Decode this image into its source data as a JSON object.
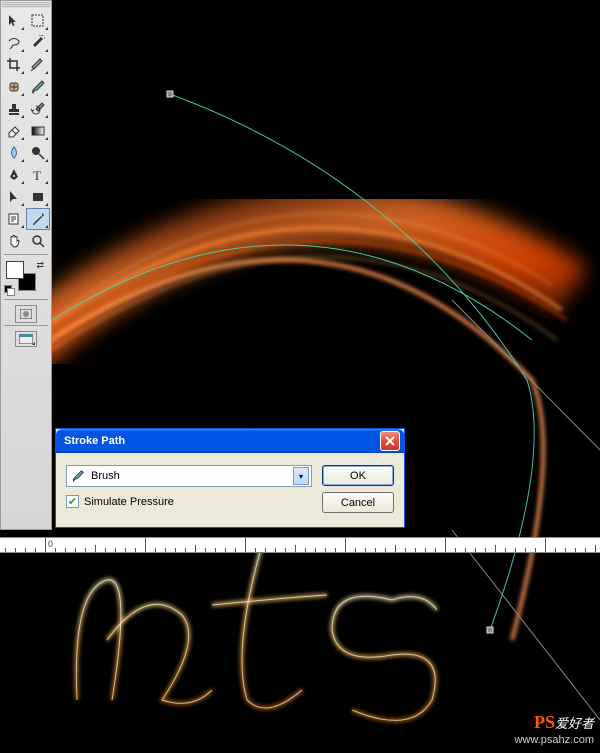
{
  "dialog": {
    "title": "Stroke Path",
    "tool_label": "Brush",
    "simulate_pressure_label": "Simulate Pressure",
    "simulate_pressure_checked": true,
    "ok_label": "OK",
    "cancel_label": "Cancel"
  },
  "ruler": {
    "major_label": "0"
  },
  "watermark": {
    "prefix": "PS",
    "suffix": "爱好者",
    "url": "www.psahz.com"
  },
  "toolbox": {
    "foreground": "#ffffff",
    "background": "#000000"
  }
}
